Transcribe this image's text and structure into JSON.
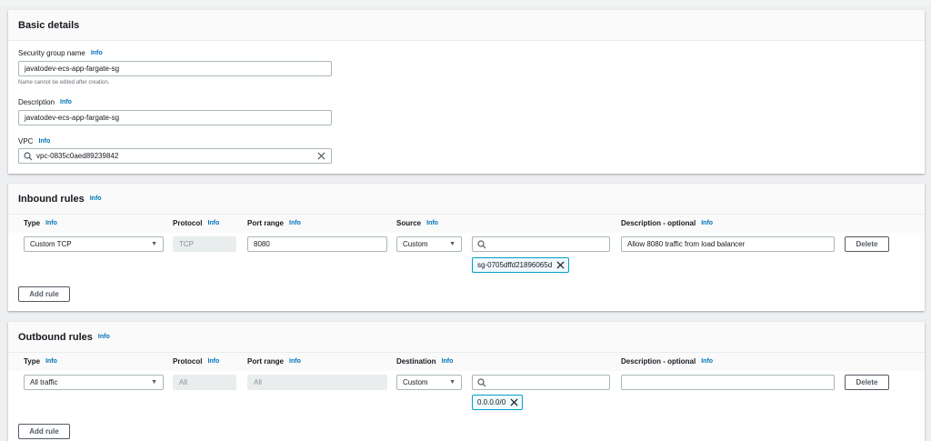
{
  "basic": {
    "title": "Basic details",
    "sg_name_label": "Security group name",
    "sg_name_value": "javatodev-ecs-app-fargate-sg",
    "sg_name_hint": "Name cannot be edited after creation.",
    "desc_label": "Description",
    "desc_value": "javatodev-ecs-app-fargate-sg",
    "vpc_label": "VPC",
    "vpc_value": "vpc-0835c0aed89239842"
  },
  "info": "Info",
  "inbound": {
    "title": "Inbound rules",
    "col_type": "Type",
    "col_protocol": "Protocol",
    "col_port": "Port range",
    "col_source": "Source",
    "col_desc": "Description - optional",
    "type_value": "Custom TCP",
    "protocol_value": "TCP",
    "port_value": "8080",
    "source_value": "Custom",
    "search_value": "",
    "desc_value": "Allow 8080 traffic from load balancer",
    "token": "sg-0705dffd21896065d",
    "delete_label": "Delete",
    "add_rule_label": "Add rule"
  },
  "outbound": {
    "title": "Outbound rules",
    "col_type": "Type",
    "col_protocol": "Protocol",
    "col_port": "Port range",
    "col_dest": "Destination",
    "col_desc": "Description - optional",
    "type_value": "All traffic",
    "protocol_value": "All",
    "port_value": "All",
    "dest_value": "Custom",
    "search_value": "",
    "desc_value": "",
    "token": "0.0.0.0/0",
    "delete_label": "Delete",
    "add_rule_label": "Add rule"
  }
}
